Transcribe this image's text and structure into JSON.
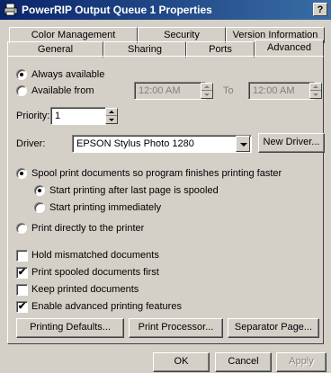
{
  "window": {
    "title": "PowerRIP Output Queue 1 Properties",
    "help_label": "?",
    "title_gradient": [
      "#0a246a",
      "#3a6ea5"
    ],
    "face_color": "#d4d0c8"
  },
  "tabs": {
    "row1": [
      "Color Management",
      "Security",
      "Version Information"
    ],
    "row2": [
      "General",
      "Sharing",
      "Ports",
      "Advanced"
    ],
    "active": "Advanced"
  },
  "availability": {
    "always_label": "Always available",
    "from_label": "Available from",
    "from_time": "12:00 AM",
    "to_label": "To",
    "to_time": "12:00 AM",
    "selected": "always"
  },
  "priority": {
    "label": "Priority:",
    "value": "1"
  },
  "driver": {
    "label": "Driver:",
    "value": "EPSON Stylus Photo 1280",
    "new_driver_label": "New Driver..."
  },
  "spool": {
    "spool_label": "Spool print documents so program finishes printing faster",
    "after_last_label": "Start printing after last page is spooled",
    "immediately_label": "Start printing immediately",
    "direct_label": "Print directly to the printer",
    "selected": "spool",
    "sub_selected": "after_last"
  },
  "options": [
    {
      "label": "Hold mismatched documents",
      "checked": false
    },
    {
      "label": "Print spooled documents first",
      "checked": true
    },
    {
      "label": "Keep printed documents",
      "checked": false
    },
    {
      "label": "Enable advanced printing features",
      "checked": true
    }
  ],
  "check_glyph": "✔",
  "buttons": {
    "defaults": "Printing Defaults...",
    "processor": "Print Processor...",
    "separator": "Separator Page..."
  },
  "footer": {
    "ok": "OK",
    "cancel": "Cancel",
    "apply": "Apply"
  }
}
